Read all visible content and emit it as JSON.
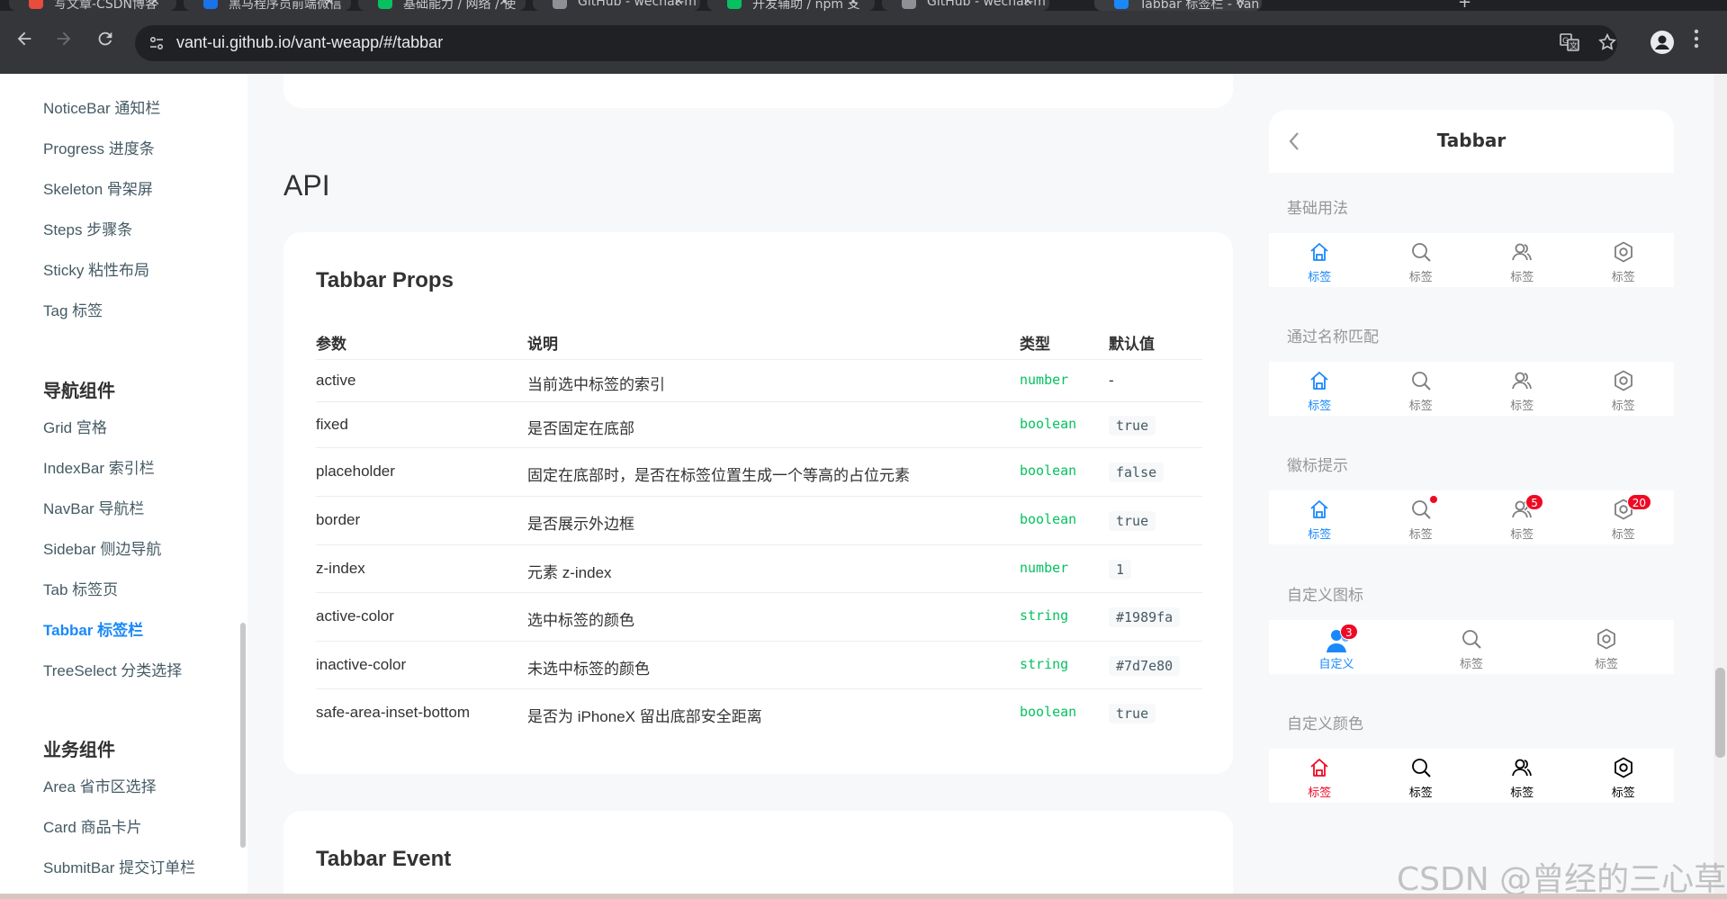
{
  "browser": {
    "tabs": [
      {
        "title": "写文章-CSDN博客",
        "color": "#e94b3c"
      },
      {
        "title": "黑马程序员前端微信",
        "color": "#1a73e8"
      },
      {
        "title": "基础能力 / 网络 / 使",
        "color": "#07c160"
      },
      {
        "title": "GitHub - wechat-m",
        "color": "#8e9096"
      },
      {
        "title": "开发辅助 / npm 支",
        "color": "#07c160"
      },
      {
        "title": "GitHub - wechat-m",
        "color": "#8e9096"
      },
      {
        "title": "Tabbar 标签栏 - Van",
        "color": "#1989fa"
      }
    ],
    "url": "vant-ui.github.io/vant-weapp/#/tabbar"
  },
  "sidebar": {
    "items_top": [
      "NoticeBar 通知栏",
      "Progress 进度条",
      "Skeleton 骨架屏",
      "Steps 步骤条",
      "Sticky 粘性布局",
      "Tag 标签"
    ],
    "group_nav": "导航组件",
    "items_nav": [
      "Grid 宫格",
      "IndexBar 索引栏",
      "NavBar 导航栏",
      "Sidebar 侧边导航",
      "Tab 标签页",
      "Tabbar 标签栏",
      "TreeSelect 分类选择"
    ],
    "group_biz": "业务组件",
    "items_biz": [
      "Area 省市区选择",
      "Card 商品卡片",
      "SubmitBar 提交订单栏"
    ]
  },
  "content": {
    "api_title": "API",
    "props_title": "Tabbar Props",
    "event_title": "Tabbar Event",
    "headers": [
      "参数",
      "说明",
      "类型",
      "默认值"
    ],
    "rows": [
      {
        "name": "active",
        "desc": "当前选中标签的索引",
        "type": "number",
        "default": "-"
      },
      {
        "name": "fixed",
        "desc": "是否固定在底部",
        "type": "boolean",
        "default": "true"
      },
      {
        "name": "placeholder",
        "desc": "固定在底部时，是否在标签位置生成一个等高的占位元素",
        "type": "boolean",
        "default": "false"
      },
      {
        "name": "border",
        "desc": "是否展示外边框",
        "type": "boolean",
        "default": "true"
      },
      {
        "name": "z-index",
        "desc": "元素 z-index",
        "type": "number",
        "default": "1"
      },
      {
        "name": "active-color",
        "desc": "选中标签的颜色",
        "type": "string",
        "default": "#1989fa"
      },
      {
        "name": "inactive-color",
        "desc": "未选中标签的颜色",
        "type": "string",
        "default": "#7d7e80"
      },
      {
        "name": "safe-area-inset-bottom",
        "desc": "是否为 iPhoneX 留出底部安全距离",
        "type": "boolean",
        "default": "true"
      }
    ]
  },
  "phone": {
    "title": "Tabbar",
    "sections": [
      {
        "title": "基础用法",
        "items": [
          {
            "icon": "home-icon",
            "label": "标签",
            "active": true
          },
          {
            "icon": "search-icon",
            "label": "标签"
          },
          {
            "icon": "friends-icon",
            "label": "标签"
          },
          {
            "icon": "setting-icon",
            "label": "标签"
          }
        ]
      },
      {
        "title": "通过名称匹配",
        "items": [
          {
            "icon": "home-icon",
            "label": "标签",
            "active": true
          },
          {
            "icon": "search-icon",
            "label": "标签"
          },
          {
            "icon": "friends-icon",
            "label": "标签"
          },
          {
            "icon": "setting-icon",
            "label": "标签"
          }
        ]
      },
      {
        "title": "徽标提示",
        "items": [
          {
            "icon": "home-icon",
            "label": "标签",
            "active": true
          },
          {
            "icon": "search-icon",
            "label": "标签",
            "dot": true
          },
          {
            "icon": "friends-icon",
            "label": "标签",
            "badge": "5"
          },
          {
            "icon": "setting-icon",
            "label": "标签",
            "badge": "20"
          }
        ]
      },
      {
        "title": "自定义图标",
        "items": [
          {
            "icon": "avatar-icon",
            "label": "自定义",
            "active": true,
            "badge": "3"
          },
          {
            "icon": "search-icon",
            "label": "标签"
          },
          {
            "icon": "setting-icon",
            "label": "标签"
          }
        ]
      },
      {
        "title": "自定义颜色",
        "items": [
          {
            "icon": "home-icon",
            "label": "标签",
            "active": true,
            "color": "#ee0a24"
          },
          {
            "icon": "search-icon",
            "label": "标签",
            "color": "#000000"
          },
          {
            "icon": "friends-icon",
            "label": "标签",
            "color": "#000000"
          },
          {
            "icon": "setting-icon",
            "label": "标签",
            "color": "#000000"
          }
        ]
      }
    ]
  },
  "watermark": "CSDN @曾经的三心草",
  "colors": {
    "active": "#1989fa",
    "inactive": "#7d7e80",
    "type": "#07c160",
    "badge": "#ee0a24"
  }
}
